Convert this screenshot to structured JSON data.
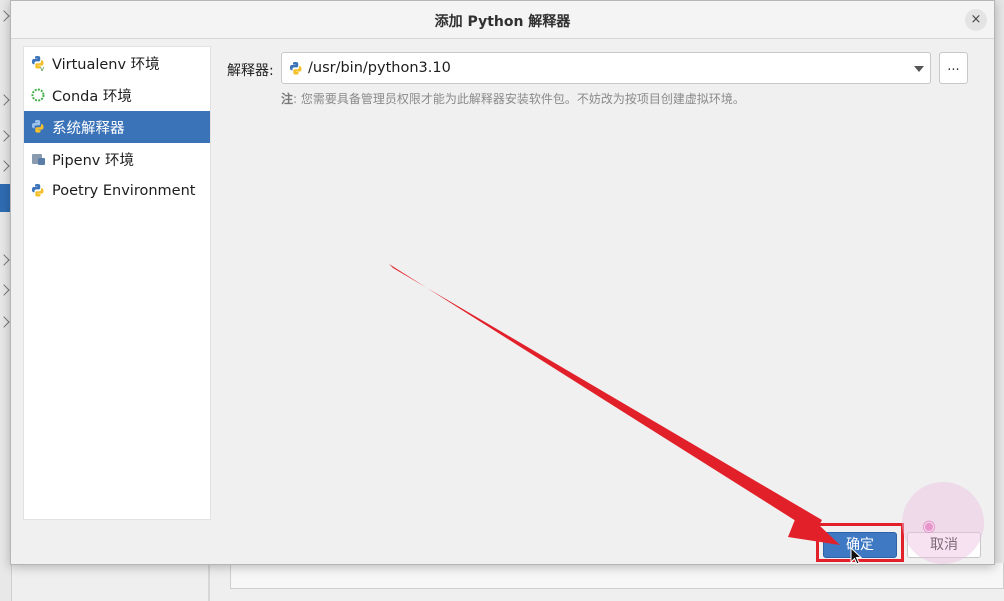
{
  "dialog": {
    "title": "添加 Python 解释器",
    "close_label": "×"
  },
  "env_list": [
    {
      "label": "Virtualenv 环境",
      "icon": "python-venv-icon",
      "selected": false
    },
    {
      "label": "Conda 环境",
      "icon": "conda-ring-icon",
      "selected": false
    },
    {
      "label": "系统解释器",
      "icon": "python-icon",
      "selected": true
    },
    {
      "label": "Pipenv 环境",
      "icon": "pipenv-icon",
      "selected": false
    },
    {
      "label": "Poetry Environment",
      "icon": "poetry-icon",
      "selected": false
    }
  ],
  "interpreter": {
    "label": "解释器:",
    "value": "/usr/bin/python3.10",
    "browse_label": "...",
    "note_prefix": "注",
    "note_text": ": 您需要具备管理员权限才能为此解释器安装软件包。不妨改为按项目创建虚拟环境。"
  },
  "buttons": {
    "ok_label": "确定",
    "cancel_label": "取消"
  },
  "colors": {
    "selection": "#3a73b8",
    "primary_button": "#3f78c3",
    "annotation_red": "#e2202a"
  }
}
